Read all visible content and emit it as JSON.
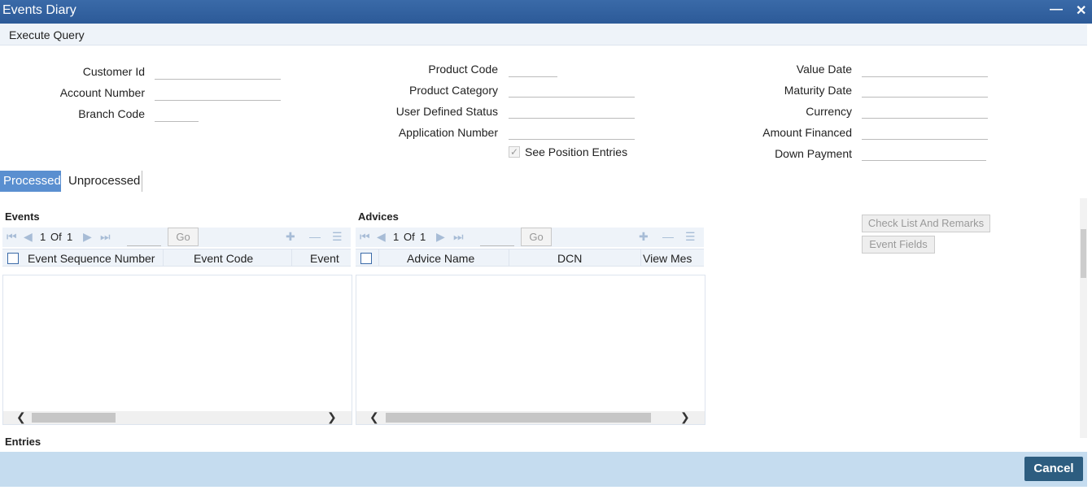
{
  "window": {
    "title": "Events Diary",
    "minimize_icon": "minimize-icon",
    "close_icon": "close-icon"
  },
  "toolbar": {
    "execute_query": "Execute Query"
  },
  "form": {
    "customer_id": {
      "label": "Customer Id",
      "value": ""
    },
    "account_number": {
      "label": "Account Number",
      "value": ""
    },
    "branch_code": {
      "label": "Branch Code",
      "value": ""
    },
    "product_code": {
      "label": "Product Code",
      "value": ""
    },
    "product_category": {
      "label": "Product Category",
      "value": ""
    },
    "user_defined_status": {
      "label": "User Defined Status",
      "value": ""
    },
    "application_number": {
      "label": "Application Number",
      "value": ""
    },
    "see_position_entries": {
      "label": "See Position Entries",
      "checked": true
    },
    "value_date": {
      "label": "Value Date",
      "value": ""
    },
    "maturity_date": {
      "label": "Maturity Date",
      "value": ""
    },
    "currency": {
      "label": "Currency",
      "value": ""
    },
    "amount_financed": {
      "label": "Amount Financed",
      "value": ""
    },
    "down_payment": {
      "label": "Down Payment",
      "value": ""
    }
  },
  "tabs": [
    {
      "label": "Processed",
      "active": true
    },
    {
      "label": "Unprocessed",
      "active": false
    }
  ],
  "events": {
    "title": "Events",
    "pager": {
      "current": "1",
      "of_label": "Of",
      "total": "1",
      "go": "Go"
    },
    "columns": [
      "Event Sequence Number",
      "Event Code",
      "Event"
    ]
  },
  "advices": {
    "title": "Advices",
    "pager": {
      "current": "1",
      "of_label": "Of",
      "total": "1",
      "go": "Go"
    },
    "columns": [
      "Advice Name",
      "DCN",
      "View Mes"
    ]
  },
  "buttons": {
    "check_list": "Check List And Remarks",
    "event_fields": "Event Fields",
    "cancel": "Cancel"
  },
  "entries": {
    "title": "Entries"
  },
  "colors": {
    "titlebar": "#2c5a98",
    "active_tab": "#5a8fd0",
    "footer": "#c5dcef",
    "cancel_button": "#2d5d80"
  }
}
